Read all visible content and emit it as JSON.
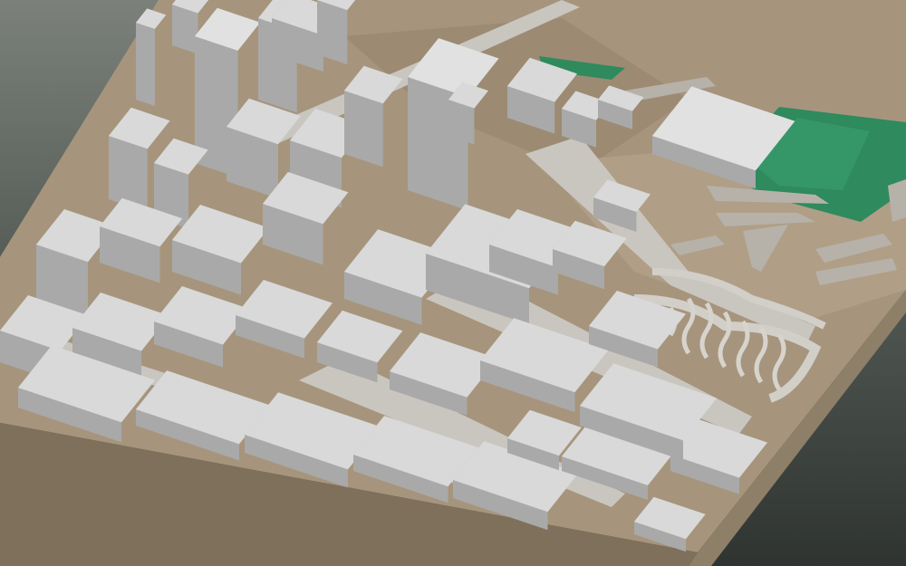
{
  "scene": {
    "kind": "3d-city-block-model",
    "colors": {
      "background_top": "#7b817a",
      "background_bottom": "#2f3431",
      "ground": "#a6957c",
      "ground_side": "#8e7f68",
      "park": "#2f8a5e",
      "roads": "#c9c6c0",
      "buildings": "#d9d9d9"
    },
    "features": [
      "downtown-towers",
      "low-rise-grid",
      "interchange-ramps",
      "green-park"
    ]
  }
}
